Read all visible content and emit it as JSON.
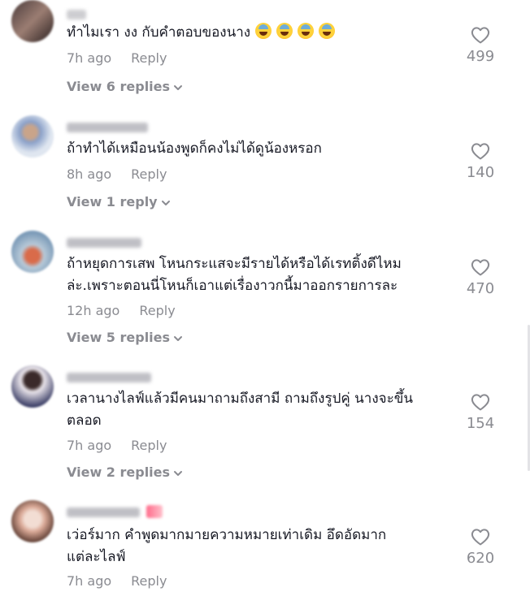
{
  "comments": [
    {
      "text": "ทำไมเรา งง กับคำตอบของนาง",
      "emoji_count": 4,
      "time": "7h ago",
      "reply": "Reply",
      "likes": "499",
      "view_replies": "View 6 replies",
      "avatar_colors": [
        "#4a3b3b",
        "#9b7d72",
        "#2a2020"
      ]
    },
    {
      "text": "ถ้าทำได้เหมือนน้องพูดก็คงไม่ได้ดูน้องหรอก",
      "emoji_count": 0,
      "time": "8h ago",
      "reply": "Reply",
      "likes": "140",
      "view_replies": "View 1 reply",
      "avatar_colors": [
        "#dfe6f0",
        "#8aa0c8",
        "#c9a48a"
      ]
    },
    {
      "text": "ถ้าหยุดการเสพ โหนกระแสจะมีรายได้หรือได้เรทติ้งดีไหม\nล่ะ.เพราะตอนนี่โหนก็เอาแต่เรื่องาวกนี้มาออกรายการละ",
      "emoji_count": 0,
      "time": "12h ago",
      "reply": "Reply",
      "likes": "470",
      "view_replies": "View 5 replies",
      "avatar_colors": [
        "#b7c9d8",
        "#d96b4a",
        "#7c9bb8"
      ]
    },
    {
      "text": "เวลานางไลฟ์แล้วมีคนมาถามถึงสามี ถามถึงรูปคู่ นางจะขึ้น\nตลอด",
      "emoji_count": 0,
      "time": "7h ago",
      "reply": "Reply",
      "likes": "154",
      "view_replies": "View 2 replies",
      "avatar_colors": [
        "#e9e4ea",
        "#2b2f5a",
        "#3a2a2a"
      ]
    },
    {
      "text": "เว่อร์มาก คำพูดมากมายความหมายเท่าเดิม อึดอัดมาก\nแต่ละไลฟ์",
      "emoji_count": 0,
      "time": "7h ago",
      "reply": "Reply",
      "likes": "620",
      "view_replies": "",
      "avatar_colors": [
        "#f2ddd3",
        "#5a3a30",
        "#d9a896"
      ]
    }
  ],
  "icons": {
    "like": "heart-outline-icon",
    "expand": "chevron-down-icon"
  },
  "colors": {
    "text": "#161823",
    "muted": "#8a8b91",
    "blurred_name": "#b9b9bf"
  }
}
